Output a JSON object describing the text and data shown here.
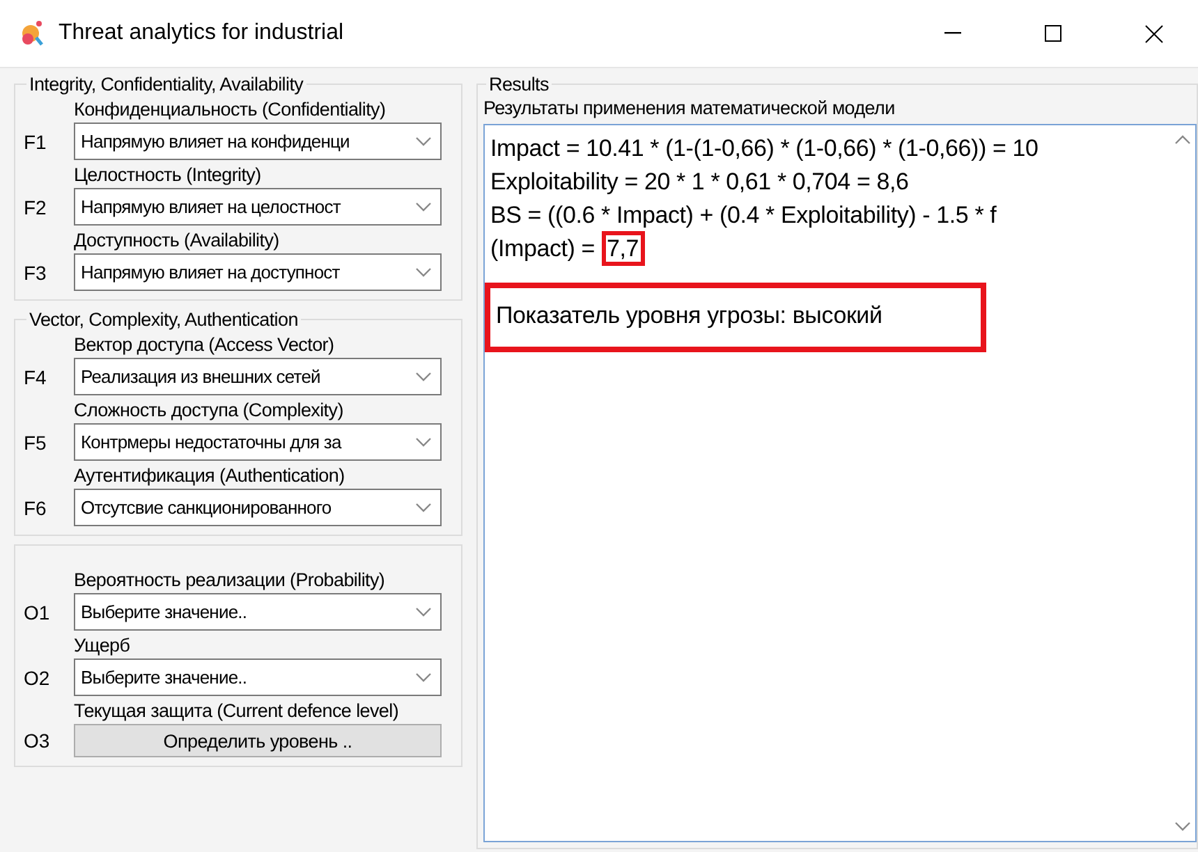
{
  "window": {
    "title": "Threat analytics for industrial"
  },
  "groups": [
    {
      "title": "Integrity, Confidentiality, Availability",
      "fields": [
        {
          "label": "Конфиденциальность  (Confidentiality)",
          "code": "F1",
          "kind": "select",
          "value": "Напрямую влияет на конфиденци"
        },
        {
          "label": "Целостность  (Integrity)",
          "code": "F2",
          "kind": "select",
          "value": "Напрямую влияет на целостност"
        },
        {
          "label": "Доступность  (Availability)",
          "code": "F3",
          "kind": "select",
          "value": "Напрямую влияет на доступност"
        }
      ]
    },
    {
      "title": "Vector, Complexity, Authentication",
      "fields": [
        {
          "label": "Вектор доступа  (Access Vector)",
          "code": "F4",
          "kind": "select",
          "value": "Реализация из внешних сетей"
        },
        {
          "label": "Сложность доступа (Complexity)",
          "code": "F5",
          "kind": "select",
          "value": "Контрмеры недостаточны для за"
        },
        {
          "label": "Аутентификация (Authentication)",
          "code": "F6",
          "kind": "select",
          "value": "Отсутсвие санкционированного"
        }
      ]
    },
    {
      "fields": [
        {
          "label": "Вероятность реализации (Probability)",
          "code": "O1",
          "kind": "select",
          "value": "Выберите значение.."
        },
        {
          "label": "Ущерб",
          "code": "O2",
          "kind": "select",
          "value": "Выберите значение.."
        },
        {
          "label": "Текущая защита (Current defence level)",
          "code": "O3",
          "kind": "button",
          "value": "Определить уровень .."
        }
      ]
    }
  ],
  "results": {
    "title": "Results",
    "subtitle": "Результаты применения математической модели",
    "lines": [
      {
        "text": "Impact = 10.41 * (1-(1-0,66) * (1-0,66) * (1-0,66)) = 10"
      },
      {
        "text": "Exploitability = 20 * 1 * 0,61 * 0,704 = 8,6"
      },
      {
        "text": "BS = ((0.6 * Impact) + (0.4 * Exploitability) - 1.5 * f"
      },
      {
        "text": "(Impact) = ",
        "highlight": "7,7"
      }
    ],
    "verdict": {
      "text": "Показатель уровня угрозы: высокий",
      "highlighted": true
    }
  }
}
